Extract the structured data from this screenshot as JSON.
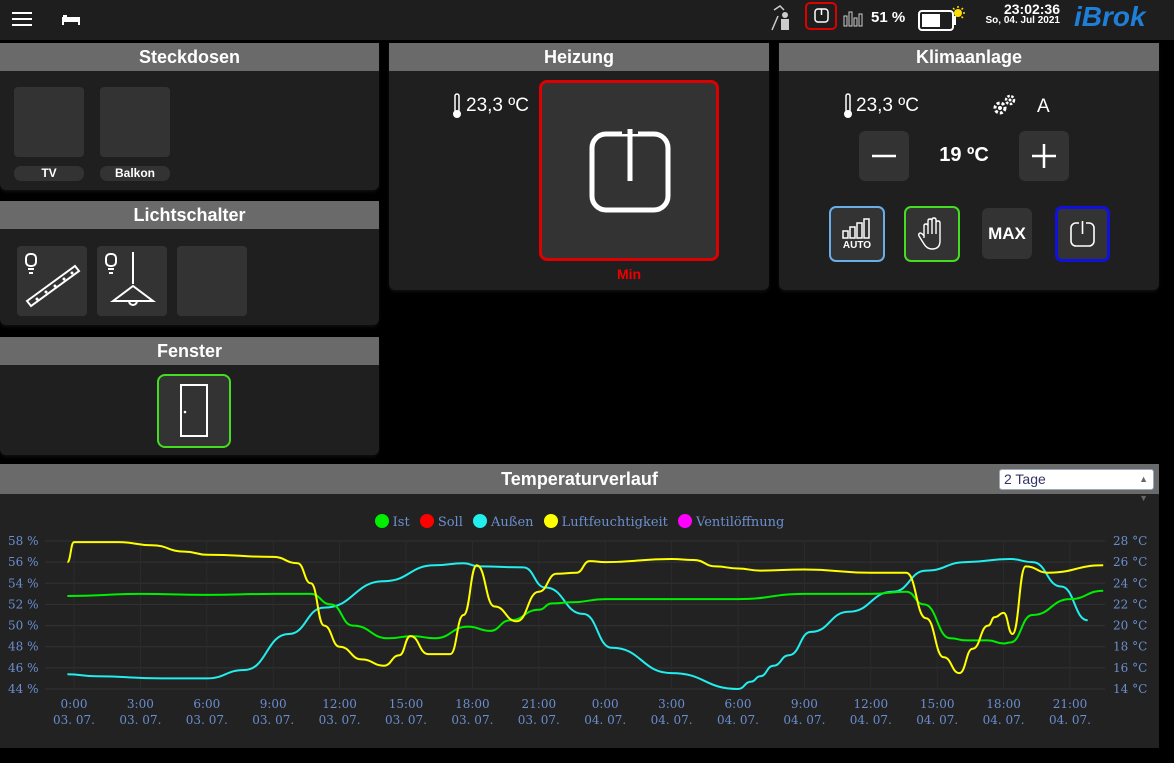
{
  "topbar": {
    "battery_percent": "51 %",
    "time": "23:02:36",
    "date": "So, 04. Jul 2021",
    "logo": "iBrok"
  },
  "steckdosen": {
    "title": "Steckdosen",
    "items": [
      {
        "label": "TV"
      },
      {
        "label": "Balkon"
      }
    ]
  },
  "lichtschalter": {
    "title": "Lichtschalter"
  },
  "fenster": {
    "title": "Fenster"
  },
  "heizung": {
    "title": "Heizung",
    "temperature": "23,3 ºC",
    "mode_label": "Min"
  },
  "klima": {
    "title": "Klimaanlage",
    "temperature": "23,3 ºC",
    "fan_mode": "A",
    "setpoint": "19 ºC",
    "auto_label": "AUTO",
    "max_label": "MAX"
  },
  "chart": {
    "title": "Temperaturverlauf",
    "range_selected": "2 Tage"
  },
  "chart_data": {
    "type": "line",
    "title": "Temperaturverlauf",
    "legend": [
      "Ist",
      "Soll",
      "Außen",
      "Luftfeuchtigkeit",
      "Ventilöffnung"
    ],
    "legend_colors": [
      "#00ee00",
      "#ff0000",
      "#22eeee",
      "#ffff00",
      "#ff00ff"
    ],
    "legend_placement": "top-center",
    "y_left_ticks": [
      "58 %",
      "56 %",
      "54 %",
      "52 %",
      "50 %",
      "48 %",
      "46 %",
      "44 %"
    ],
    "y_left_lim": [
      44,
      58
    ],
    "y_right_ticks": [
      "28 °C",
      "26 °C",
      "24 °C",
      "22 °C",
      "20 °C",
      "18 °C",
      "16 °C",
      "14 °C"
    ],
    "y_right_lim": [
      14,
      28
    ],
    "x_ticks": [
      {
        "time": "0:00",
        "date": "03. 07."
      },
      {
        "time": "3:00",
        "date": "03. 07."
      },
      {
        "time": "6:00",
        "date": "03. 07."
      },
      {
        "time": "9:00",
        "date": "03. 07."
      },
      {
        "time": "12:00",
        "date": "03. 07."
      },
      {
        "time": "15:00",
        "date": "03. 07."
      },
      {
        "time": "18:00",
        "date": "03. 07."
      },
      {
        "time": "21:00",
        "date": "03. 07."
      },
      {
        "time": "0:00",
        "date": "04. 07."
      },
      {
        "time": "3:00",
        "date": "04. 07."
      },
      {
        "time": "6:00",
        "date": "04. 07."
      },
      {
        "time": "9:00",
        "date": "04. 07."
      },
      {
        "time": "12:00",
        "date": "04. 07."
      },
      {
        "time": "15:00",
        "date": "04. 07."
      },
      {
        "time": "18:00",
        "date": "04. 07."
      },
      {
        "time": "21:00",
        "date": "04. 07."
      }
    ],
    "x_unit": "hours since 03.07. 0:00",
    "series": [
      {
        "name": "Ist",
        "axis": "right",
        "color": "#00ee00",
        "x": [
          -0.3,
          3,
          6,
          9,
          10.7,
          11.6,
          12.6,
          14.2,
          15.3,
          16.3,
          17.8,
          18.8,
          19.7,
          21,
          21.6,
          22.5,
          24,
          27,
          30,
          33,
          36,
          37.6,
          38.4,
          39.6,
          40.3,
          41.3,
          42,
          42.3,
          43.3,
          45,
          46.5
        ],
        "y": [
          22.8,
          23,
          22.9,
          23,
          23,
          22,
          20,
          18.8,
          19,
          18.8,
          19.9,
          19.5,
          20.5,
          21.5,
          22.1,
          22.2,
          22.5,
          22.5,
          22.5,
          23,
          23,
          23.2,
          22,
          18.8,
          18.6,
          18.6,
          18.3,
          18.4,
          21,
          22.5,
          23.3
        ]
      },
      {
        "name": "Luftfeuchtigkeit",
        "axis": "left",
        "color": "#ffff00",
        "x": [
          -0.3,
          0,
          2,
          3.5,
          5,
          6,
          9,
          10.1,
          10.7,
          11.3,
          12,
          13,
          14,
          14.7,
          15.2,
          16,
          17,
          17.6,
          18.2,
          19,
          20,
          21,
          21.8,
          22.7,
          23.3,
          24,
          27,
          28,
          29,
          30,
          31,
          33,
          36,
          37.6,
          38.5,
          39.3,
          40,
          40.6,
          41.3,
          41.6,
          42,
          42.4,
          43,
          44,
          46.5
        ],
        "y": [
          56,
          57.9,
          57.9,
          57.6,
          57,
          56.7,
          56.5,
          55.9,
          54,
          50,
          48,
          46.8,
          46.2,
          47.2,
          49,
          47.3,
          47.3,
          51,
          55.7,
          51.8,
          50.4,
          53.2,
          54.9,
          55,
          56.1,
          56,
          56.3,
          56.2,
          55.6,
          55.4,
          55.2,
          55.3,
          55,
          55,
          50.7,
          47,
          45.5,
          47.8,
          50,
          50.8,
          51.2,
          49.2,
          55.6,
          55,
          55.7
        ]
      },
      {
        "name": "Außen",
        "axis": "right",
        "color": "#22eeee",
        "x": [
          -0.3,
          1,
          4,
          6,
          7.7,
          9.7,
          11.3,
          14,
          16.3,
          17.6,
          18.3,
          20.3,
          21.3,
          23,
          24.3,
          27,
          30,
          30.6,
          31,
          31.6,
          32.3,
          33.3,
          35,
          37,
          38.5,
          40.3,
          42.3,
          43.3,
          44.6,
          45.8
        ],
        "y": [
          15.4,
          15.2,
          15,
          15,
          15.8,
          19.2,
          21.7,
          24.2,
          25.7,
          25.9,
          25.6,
          25.5,
          23.6,
          21.1,
          17.9,
          15.5,
          14,
          14.7,
          15.2,
          16.2,
          17.2,
          19.4,
          21.3,
          23.2,
          25.2,
          26,
          26.3,
          26,
          23.7,
          20.5
        ]
      }
    ]
  }
}
